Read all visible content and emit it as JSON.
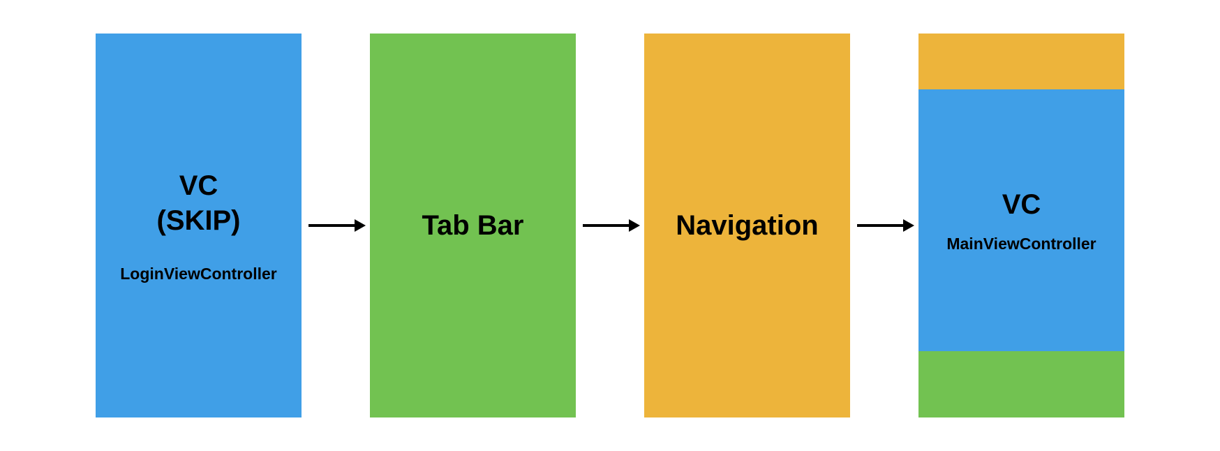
{
  "boxes": [
    {
      "title": "VC",
      "title2": "(SKIP)",
      "subtitle": "LoginViewController"
    },
    {
      "title": "Tab Bar"
    },
    {
      "title": "Navigation"
    },
    {
      "title": "VC",
      "subtitle": "MainViewController"
    }
  ]
}
